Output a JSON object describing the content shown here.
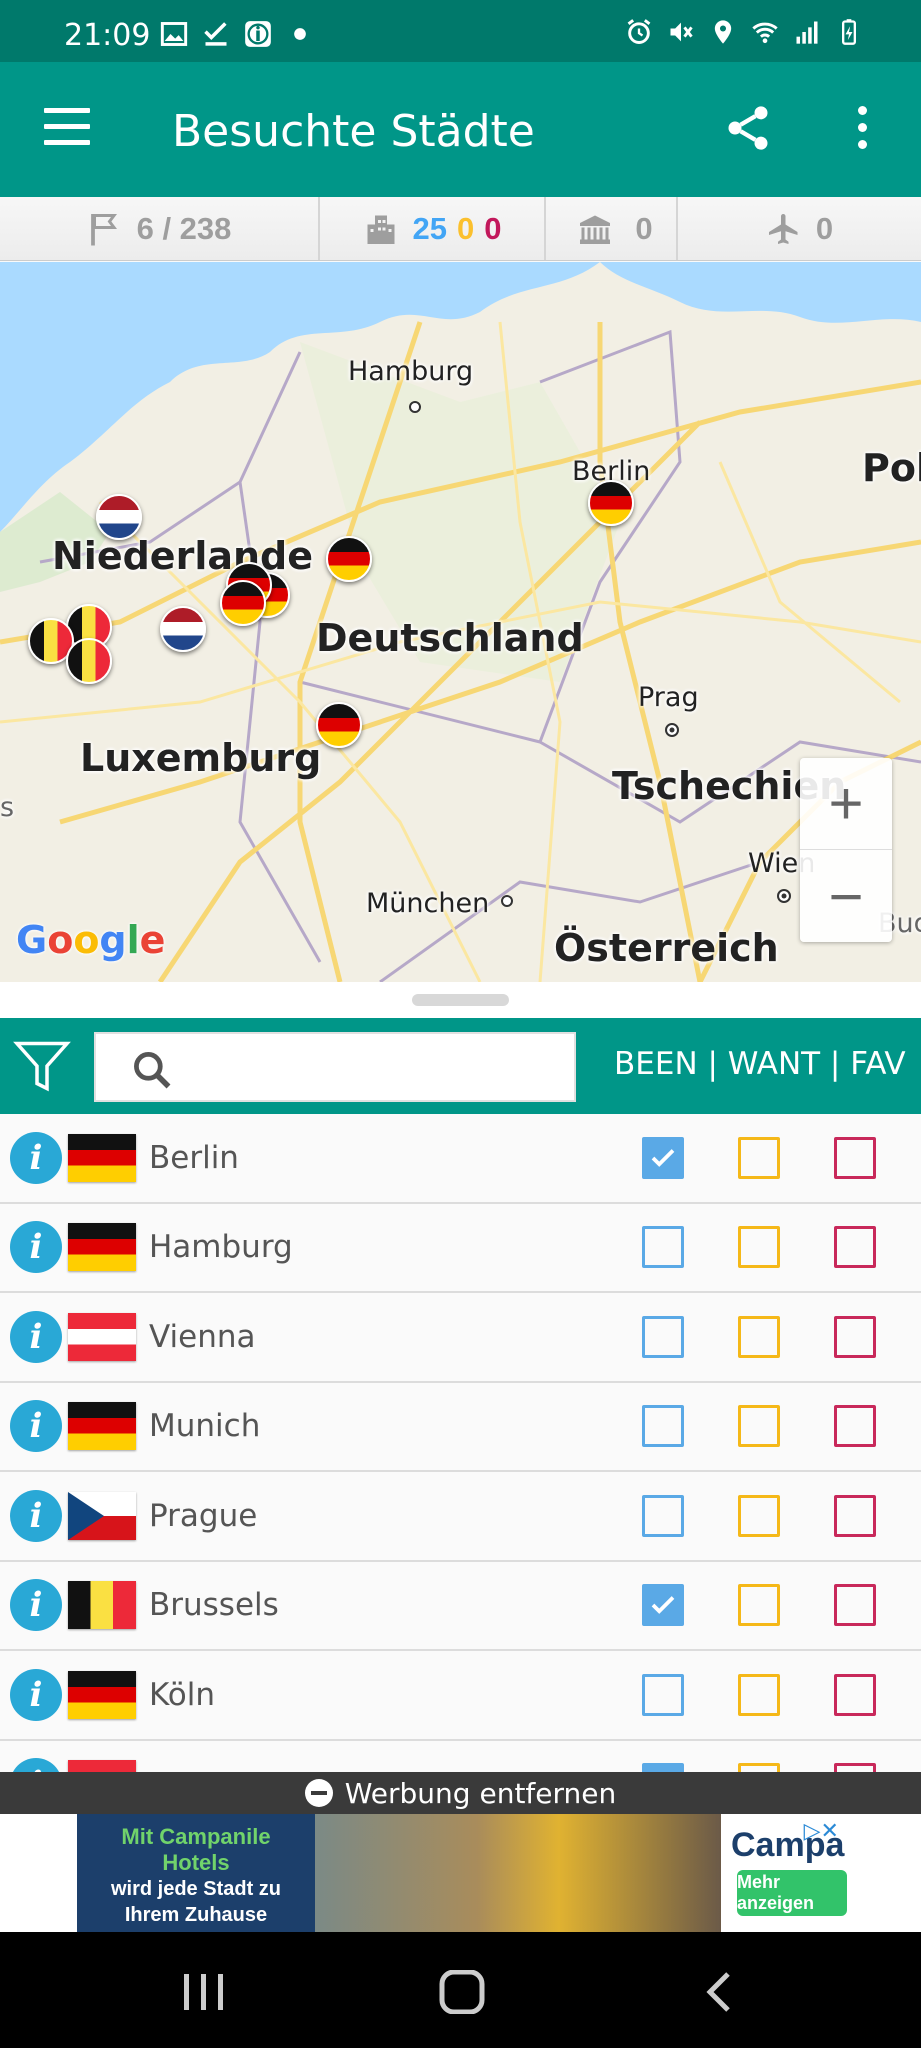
{
  "status_bar": {
    "time": "21:09",
    "left_icons": [
      "image-icon",
      "download-done-icon",
      "info-badge-icon",
      "dot-icon"
    ],
    "right_icons": [
      "alarm-icon",
      "mute-icon",
      "location-icon",
      "wifi-icon",
      "signal-icon",
      "battery-icon"
    ]
  },
  "app_bar": {
    "title": "Besuchte Städte",
    "menu_icon": "hamburger-icon",
    "share_icon": "share-icon",
    "more_icon": "more-vert-icon",
    "color": "#009688"
  },
  "stats": {
    "countries": "6 / 238",
    "cities_been": "25",
    "cities_want": "0",
    "cities_fav": "0",
    "unesco": "0",
    "flights": "0",
    "colors": {
      "been": "#42a5f5",
      "want": "#fbc02d",
      "fav": "#c2185b"
    }
  },
  "map": {
    "labels": {
      "hamburg": "Hamburg",
      "berlin": "Berlin",
      "pol": "Pol",
      "niederlande": "Niederlande",
      "deutschland": "Deutschland",
      "prag": "Prag",
      "luxemburg": "Luxemburg",
      "tschechien": "Tschechien",
      "wien": "Wien",
      "muenchen": "München",
      "oesterreich": "Österreich",
      "bud": "Bud",
      "s": "s"
    },
    "zoom_in": "+",
    "zoom_out": "−",
    "attribution": "Google"
  },
  "filter_bar": {
    "search_placeholder": "",
    "columns_label": "BEEN | WANT | FAV"
  },
  "cities": [
    {
      "name": "Berlin",
      "flag": "de",
      "been": true,
      "want": false,
      "fav": false
    },
    {
      "name": "Hamburg",
      "flag": "de",
      "been": false,
      "want": false,
      "fav": false
    },
    {
      "name": "Vienna",
      "flag": "at",
      "been": false,
      "want": false,
      "fav": false
    },
    {
      "name": "Munich",
      "flag": "de",
      "been": false,
      "want": false,
      "fav": false
    },
    {
      "name": "Prague",
      "flag": "cz",
      "been": false,
      "want": false,
      "fav": false
    },
    {
      "name": "Brussels",
      "flag": "be",
      "been": true,
      "want": false,
      "fav": false
    },
    {
      "name": "Köln",
      "flag": "de",
      "been": false,
      "want": false,
      "fav": false
    }
  ],
  "ad": {
    "remove_label": "Werbung entfernen",
    "line1": "Mit Campanile",
    "line2": "Hotels",
    "line3": "wird jede Stadt zu",
    "line4": "Ihrem Zuhause",
    "brand": "Campa",
    "cta": "Mehr anzeigen"
  },
  "nav_bar": {
    "recents_icon": "recents-icon",
    "home_icon": "home-icon",
    "back_icon": "back-icon"
  }
}
